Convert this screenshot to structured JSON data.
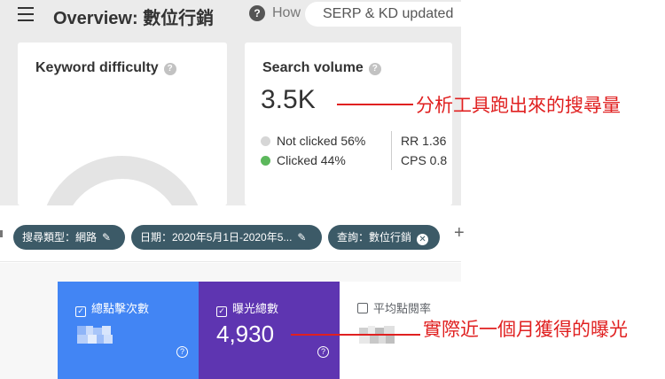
{
  "header": {
    "title": "Overview: 數位行銷",
    "help_symbol": "?",
    "how_text": "How",
    "notice": "SERP & KD updated"
  },
  "keyword_difficulty": {
    "title": "Keyword difficulty",
    "help_symbol": "?"
  },
  "search_volume": {
    "title": "Search volume",
    "help_symbol": "?",
    "value": "3.5K",
    "legend": [
      {
        "label": "Not clicked 56%",
        "color": "#d6d6d6"
      },
      {
        "label": "Clicked 44%",
        "color": "#5cb85c"
      }
    ],
    "metrics": [
      {
        "label": "RR 1.36"
      },
      {
        "label": "CPS 0.8"
      }
    ]
  },
  "annotations": {
    "search_volume_note": "分析工具跑出來的搜尋量",
    "impressions_note": "實際近一個月獲得的曝光",
    "color": "#e02020"
  },
  "filters": {
    "chips": [
      {
        "label": "搜尋類型：網路",
        "action_icon": "pencil-icon",
        "glyph": "✎"
      },
      {
        "label": "日期：2020年5月1日-2020年5...",
        "action_icon": "pencil-icon",
        "glyph": "✎"
      },
      {
        "label": "查詢：數位行銷",
        "action_icon": "close-icon",
        "glyph": "✕"
      }
    ],
    "add_symbol": "+"
  },
  "tiles": [
    {
      "label": "總點擊次數",
      "value": "",
      "checked": true,
      "color": "#4285f4"
    },
    {
      "label": "曝光總數",
      "value": "4,930",
      "checked": true,
      "color": "#5e35b1"
    },
    {
      "label": "平均點閱率",
      "value": "",
      "checked": false,
      "color": "#ffffff"
    }
  ],
  "tile_help_symbol": "?",
  "checkbox_checked_glyph": "✓"
}
